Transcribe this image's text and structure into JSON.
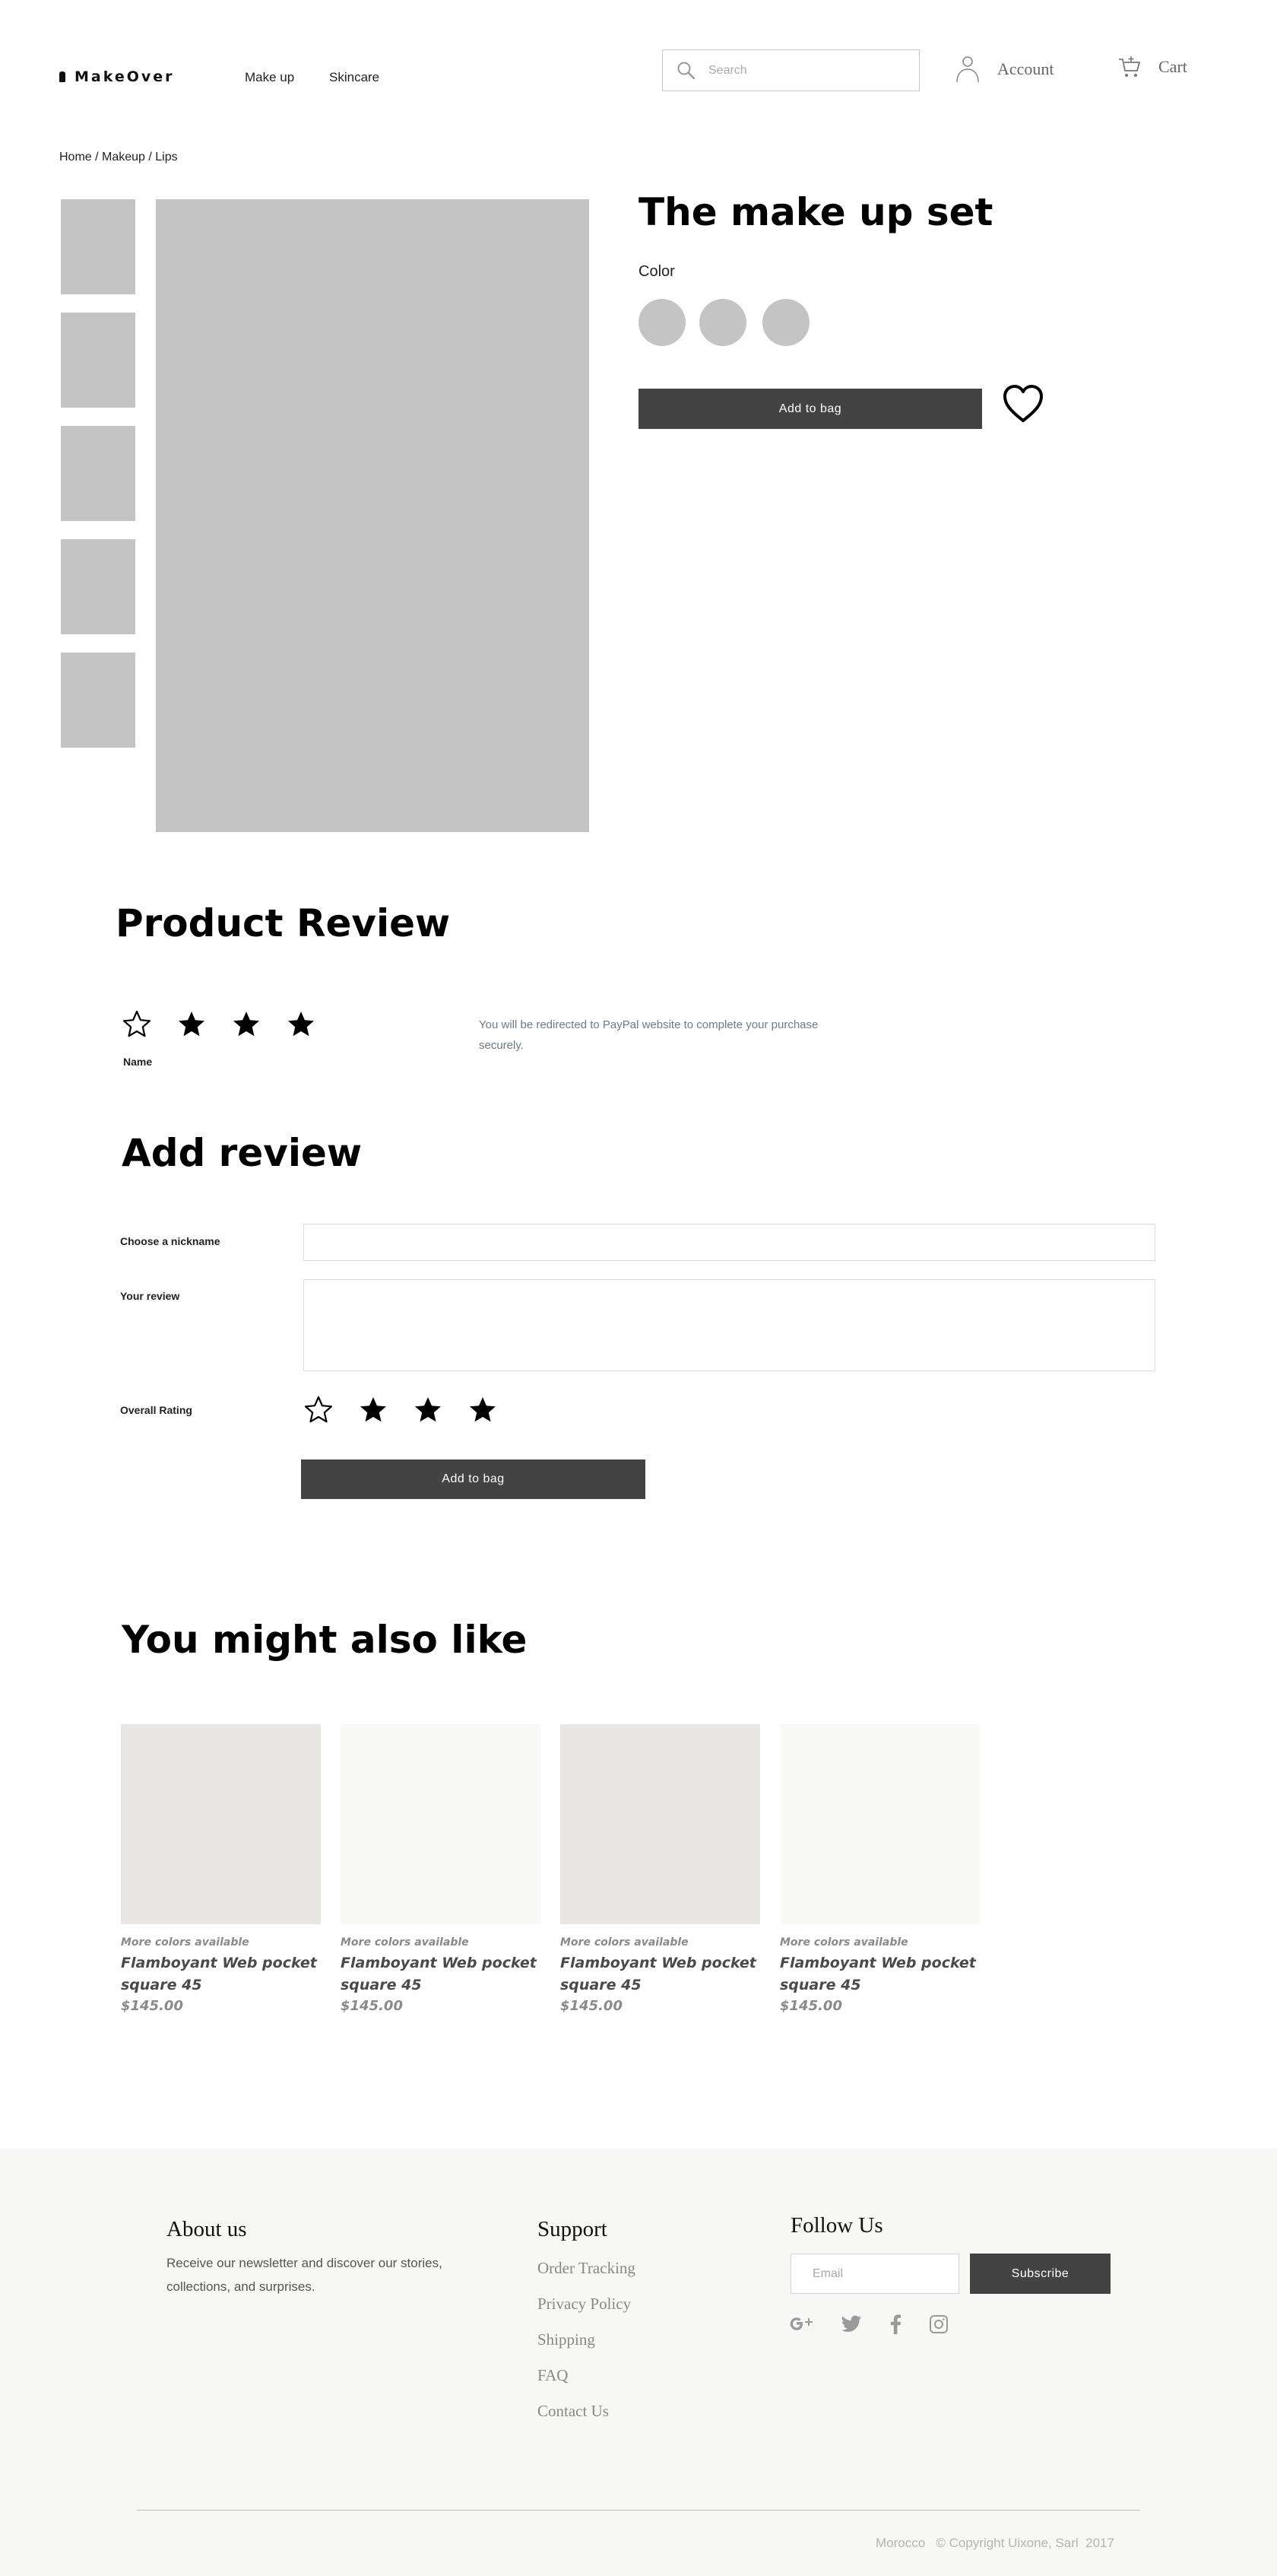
{
  "header": {
    "logo": "MakeOver",
    "nav": [
      "Make up",
      "Skincare"
    ],
    "search_placeholder": "Search",
    "account_label": "Account",
    "cart_label": "Cart"
  },
  "breadcrumb": "Home / Makeup / Lips",
  "product": {
    "title": "The make up set",
    "color_label": "Color",
    "add_to_bag": "Add to bag"
  },
  "review_section": {
    "title": "Product Review",
    "rating_stars": [
      false,
      true,
      true,
      true
    ],
    "name": "Name",
    "text": "You will be redirected to PayPal website to complete your purchase securely."
  },
  "add_review": {
    "title": "Add review",
    "nickname_label": "Choose a nickname",
    "review_label": "Your review",
    "rating_label": "Overall Rating",
    "rating_stars": [
      false,
      true,
      true,
      true
    ],
    "submit_label": "Add to bag"
  },
  "recommendations": {
    "title": "You might also like",
    "items": [
      {
        "meta": "More colors available",
        "name": "Flamboyant Web pocket square 45",
        "price": "$145.00",
        "bg": "#e8e7e3"
      },
      {
        "meta": "More colors available",
        "name": "Flamboyant Web pocket square 45",
        "price": "$145.00",
        "bg": "#f9f9f8"
      },
      {
        "meta": "More colors available",
        "name": "Flamboyant Web pocket square 45",
        "price": "$145.00",
        "bg": "#e8e7e3"
      },
      {
        "meta": "More colors available",
        "name": "Flamboyant Web pocket square 45",
        "price": "$145.00",
        "bg": "#f9f9f8"
      }
    ]
  },
  "footer": {
    "about_title": "About us",
    "about_text": "Receive our newsletter and discover our stories, collections, and surprises.",
    "support_title": "Support",
    "support_links": [
      "Order Tracking",
      "Privacy Policy",
      "Shipping",
      "FAQ",
      "Contact Us"
    ],
    "follow_title": "Follow Us",
    "email_placeholder": "Email",
    "subscribe_label": "Subscribe",
    "social_icons": [
      "google-plus-icon",
      "twitter-icon",
      "facebook-icon",
      "instagram-icon"
    ],
    "copyright": "Morocco   © Copyright Uixone, Sarl  2017"
  },
  "colors": {
    "button": "#434343",
    "placeholder_gray": "#c4c4c4",
    "footer_bg": "#f7f7f5"
  }
}
